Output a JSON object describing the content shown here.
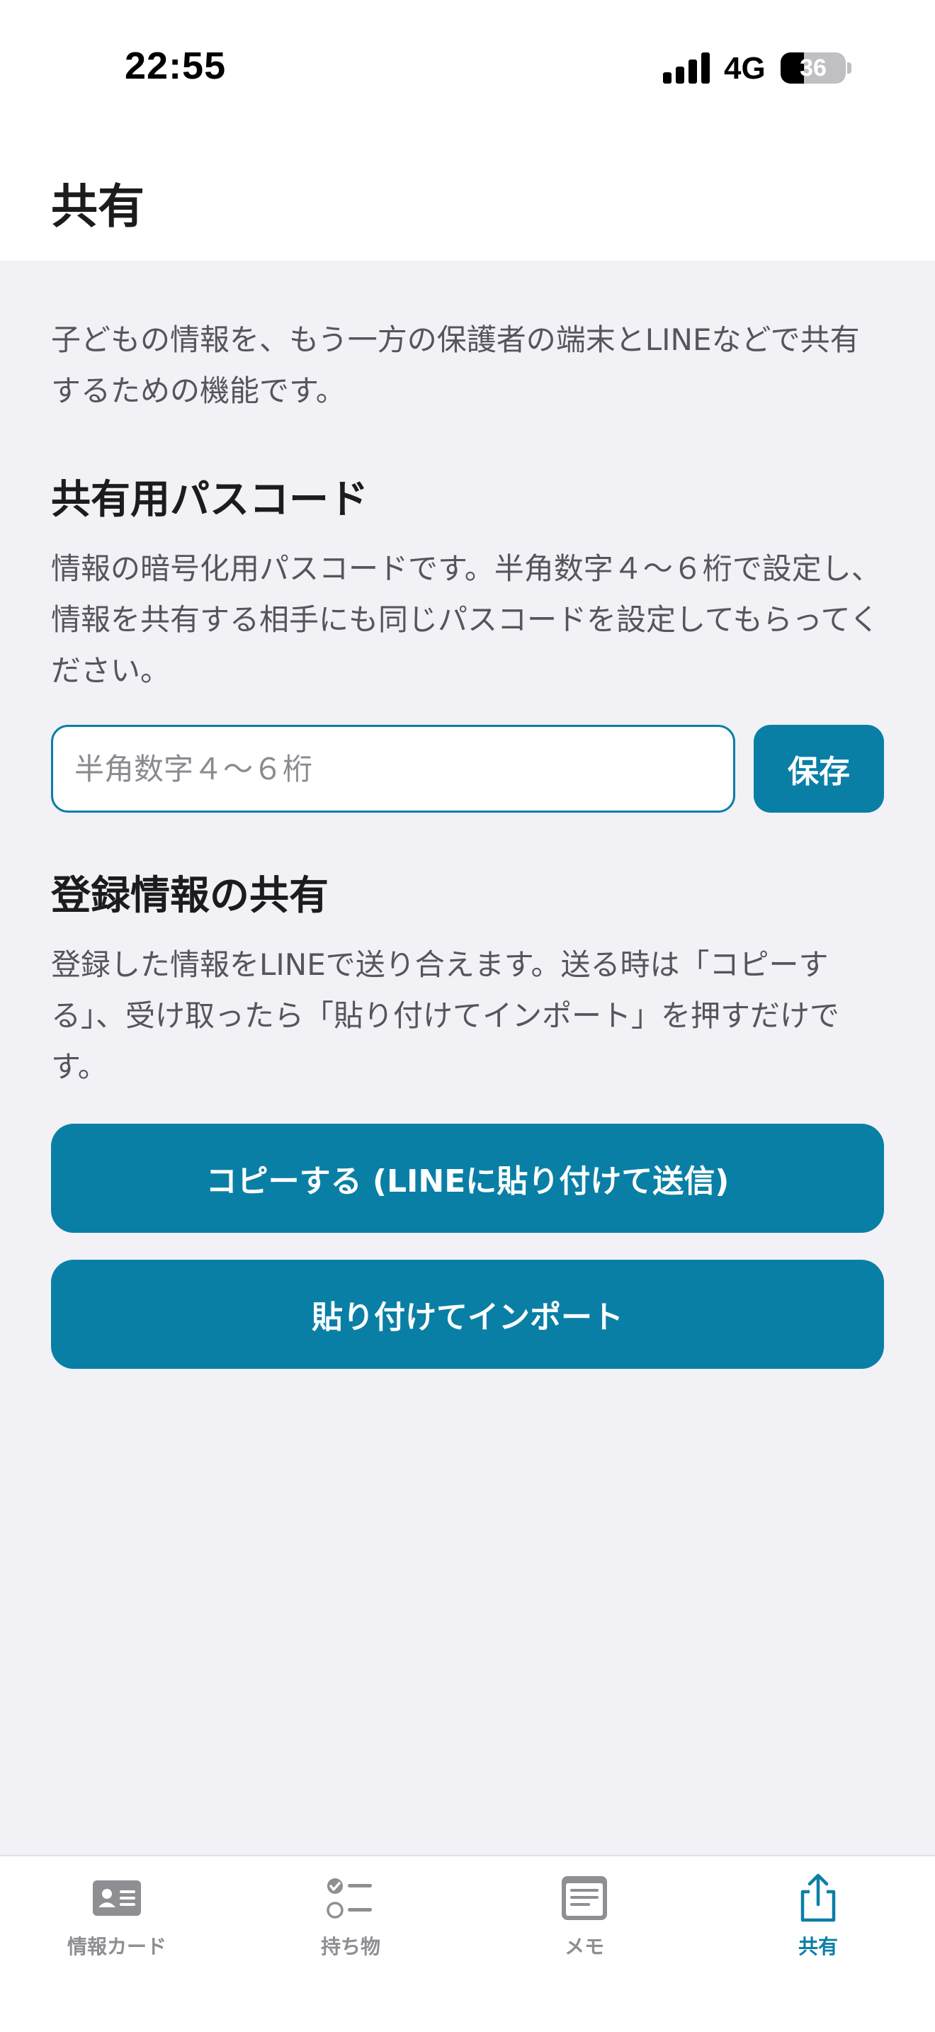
{
  "status_bar": {
    "time": "22:55",
    "network": "4G",
    "battery_level": "36",
    "battery_fraction": 0.36
  },
  "header": {
    "title": "共有"
  },
  "intro_text": "子どもの情報を、もう一方の保護者の端末とLINEなどで共有するための機能です。",
  "passcode_section": {
    "title": "共有用パスコード",
    "description": "情報の暗号化用パスコードです。半角数字４〜６桁で設定し、情報を共有する相手にも同じパスコードを設定してもらってください。",
    "input_placeholder": "半角数字４〜６桁",
    "input_value": "",
    "save_label": "保存"
  },
  "share_section": {
    "title": "登録情報の共有",
    "description": "登録した情報をLINEで送り合えます。送る時は「コピーする」、受け取ったら「貼り付けてインポート」を押すだけです。",
    "copy_label": "コピーする (LINEに貼り付けて送信)",
    "import_label": "貼り付けてインポート"
  },
  "tab_bar": {
    "items": [
      {
        "label": "情報カード",
        "icon": "id-card-icon",
        "active": false
      },
      {
        "label": "持ち物",
        "icon": "checklist-icon",
        "active": false
      },
      {
        "label": "メモ",
        "icon": "memo-icon",
        "active": false
      },
      {
        "label": "共有",
        "icon": "share-icon",
        "active": true
      }
    ]
  },
  "colors": {
    "accent": "#0a7fa6",
    "background": "#f1f1f6",
    "inactive_tab": "#8e8e93"
  }
}
